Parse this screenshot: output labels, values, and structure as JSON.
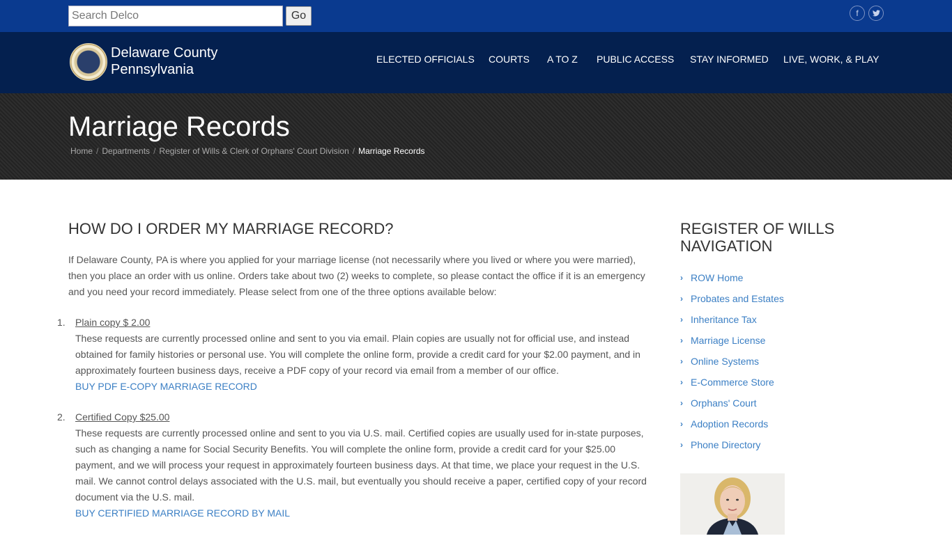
{
  "search": {
    "placeholder": "Search Delco",
    "go_label": "Go"
  },
  "social": {
    "facebook": "f",
    "twitter": "t"
  },
  "brand": {
    "line1": "Delaware County",
    "line2": "Pennsylvania"
  },
  "nav": [
    {
      "label": "ELECTED OFFICIALS"
    },
    {
      "label": "COURTS"
    },
    {
      "label": "A TO Z"
    },
    {
      "label": "PUBLIC ACCESS"
    },
    {
      "label": "STAY INFORMED"
    },
    {
      "label": "LIVE, WORK, & PLAY"
    }
  ],
  "hero": {
    "title": "Marriage Records",
    "breadcrumb": [
      "Home",
      "Departments",
      "Register of Wills & Clerk of Orphans' Court Division"
    ],
    "current": "Marriage Records"
  },
  "main": {
    "heading": "HOW DO I ORDER MY MARRIAGE RECORD?",
    "intro": "If Delaware County, PA is where you applied for your marriage license (not necessarily where you lived or where you were married), then you place an order with us online. Orders take about two (2) weeks to complete, so please contact the office if it is an emergency and you need your record immediately. Please select from one of the three options available below:",
    "options": [
      {
        "number": "1.",
        "title": "Plain copy $ 2.00",
        "text": "These requests are currently processed online and sent to you via email. Plain copies are usually not for official use, and instead obtained for family histories or personal use. You will complete the online form, provide a credit card for your $2.00 payment, and in approximately fourteen business days, receive a PDF copy of your record via email from a member of our office.",
        "link": "BUY PDF E-COPY MARRIAGE RECORD"
      },
      {
        "number": "2.",
        "title": "Certified Copy $25.00",
        "text": "These requests are currently processed online and sent to you via U.S. mail. Certified copies are usually used for in-state purposes, such as changing a name for Social Security Benefits. You will complete the online form, provide a credit card for your $25.00 payment, and we will process your request in approximately fourteen business days. At that time, we place your request in the U.S. mail. We cannot control delays associated with the U.S. mail, but eventually you should receive a paper, certified copy of your record document via the U.S. mail.",
        "link": "BUY CERTIFIED MARRIAGE RECORD BY MAIL"
      }
    ]
  },
  "sidebar": {
    "heading": "REGISTER OF WILLS NAVIGATION",
    "items": [
      {
        "label": "ROW Home"
      },
      {
        "label": "Probates and Estates"
      },
      {
        "label": "Inheritance Tax"
      },
      {
        "label": "Marriage License"
      },
      {
        "label": "Online Systems"
      },
      {
        "label": "E-Commerce Store"
      },
      {
        "label": "Orphans' Court"
      },
      {
        "label": "Adoption Records"
      },
      {
        "label": "Phone Directory"
      }
    ]
  },
  "colors": {
    "topbar": "#0a3a8f",
    "navbar": "#04204f",
    "hero": "#262626",
    "link": "#3b7fc4"
  }
}
